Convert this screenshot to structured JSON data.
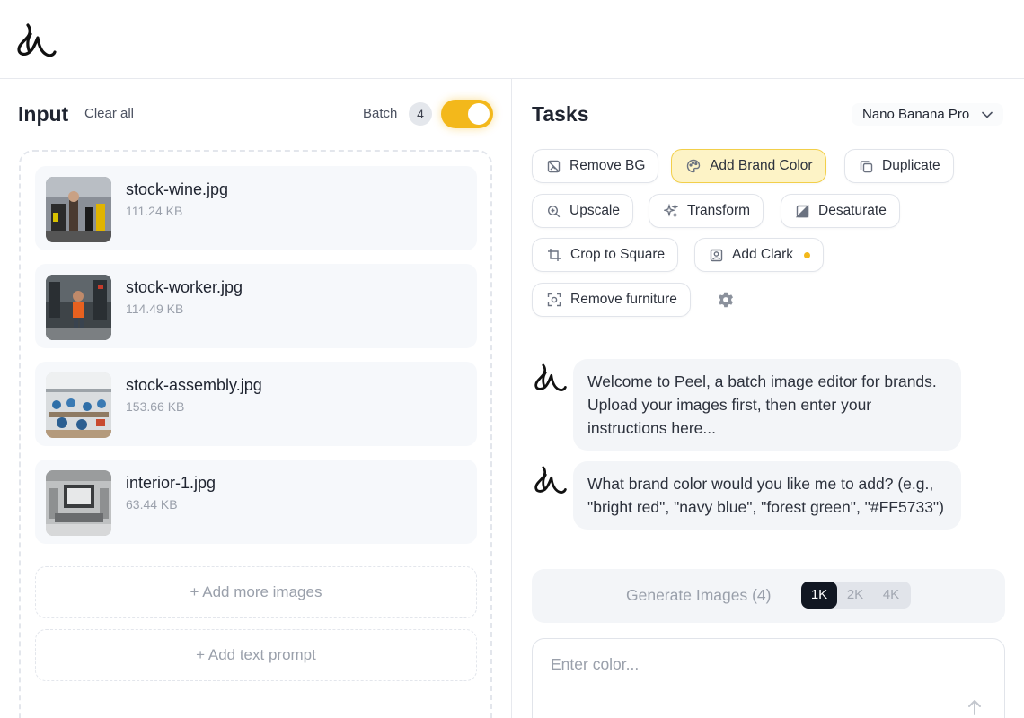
{
  "header": {
    "logo_icon": "peel-banana-logo-icon"
  },
  "input_panel": {
    "title": "Input",
    "clear_all_label": "Clear all",
    "batch_label": "Batch",
    "batch_count": "4",
    "batch_enabled": true,
    "files": [
      {
        "name": "stock-wine.jpg",
        "size": "111.24 KB"
      },
      {
        "name": "stock-worker.jpg",
        "size": "114.49 KB"
      },
      {
        "name": "stock-assembly.jpg",
        "size": "153.66 KB"
      },
      {
        "name": "interior-1.jpg",
        "size": "63.44 KB"
      }
    ],
    "add_images_label": "+ Add more images",
    "add_prompt_label": "+ Add text prompt"
  },
  "tasks_panel": {
    "title": "Tasks",
    "model": "Nano Banana Pro",
    "tasks": [
      {
        "label": "Remove BG",
        "icon": "remove-bg-icon"
      },
      {
        "label": "Add Brand Color",
        "icon": "palette-icon",
        "active": true
      },
      {
        "label": "Duplicate",
        "icon": "duplicate-icon"
      },
      {
        "label": "Upscale",
        "icon": "zoom-in-icon"
      },
      {
        "label": "Transform",
        "icon": "sparkles-icon"
      },
      {
        "label": "Desaturate",
        "icon": "desaturate-icon"
      },
      {
        "label": "Crop to Square",
        "icon": "crop-icon"
      },
      {
        "label": "Add Clark",
        "icon": "portrait-icon"
      },
      {
        "label": "Remove furniture",
        "icon": "scan-icon"
      }
    ],
    "settings_icon": "gear-icon"
  },
  "chat": {
    "messages": [
      {
        "text": "Welcome to Peel, a batch image editor for brands. Upload your images first, then enter your instructions here..."
      },
      {
        "text": "What brand color would you like me to add? (e.g., \"bright red\", \"navy blue\", \"forest green\", \"#FF5733\")"
      }
    ]
  },
  "generate": {
    "label": "Generate Images (4)",
    "resolutions": [
      "1K",
      "2K",
      "4K"
    ],
    "selected_resolution": "1K"
  },
  "prompt": {
    "placeholder": "Enter color..."
  },
  "colors": {
    "accent": "#f3b81b",
    "active_chip_bg": "#fdf3c6",
    "dark": "#111722"
  }
}
